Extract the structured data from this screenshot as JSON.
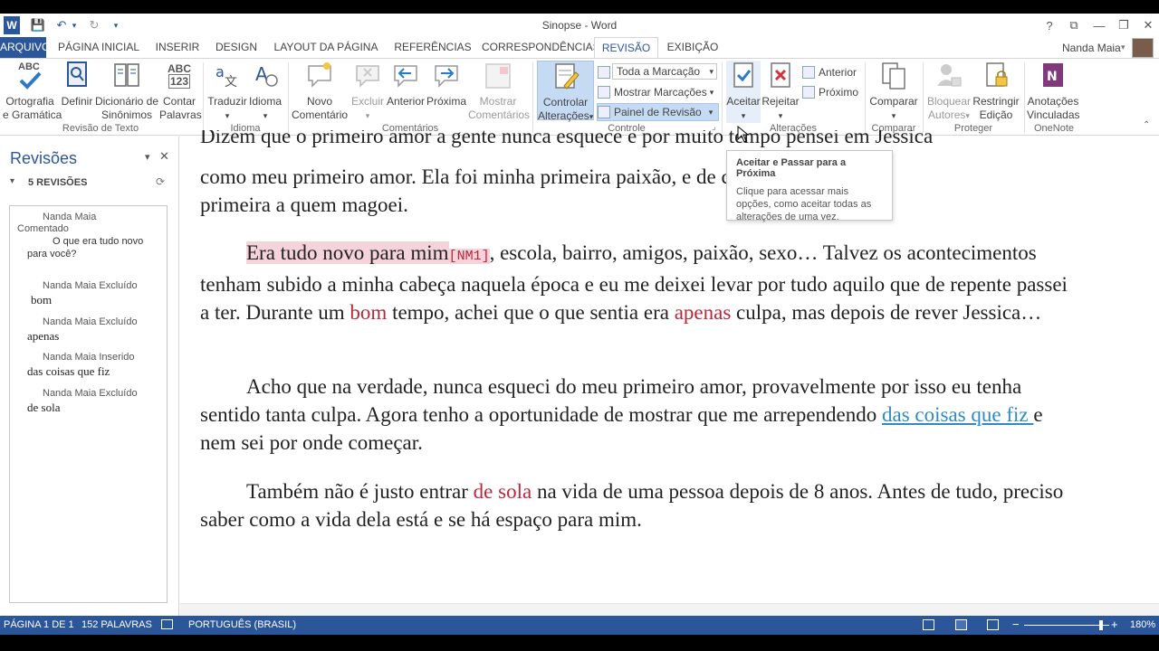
{
  "titlebar": {
    "title": "Sinopse - Word",
    "help": "?",
    "ribbon_display": "⧉",
    "minimize": "—",
    "restore": "❐",
    "close": "✕"
  },
  "qat": {
    "word_icon": "W",
    "save_icon": "💾",
    "undo_icon": "↶",
    "undo_dropdown": "▾",
    "redo_icon": "↻",
    "customize": "▾"
  },
  "tabs": [
    "ARQUIVO",
    "PÁGINA INICIAL",
    "INSERIR",
    "DESIGN",
    "LAYOUT DA PÁGINA",
    "REFERÊNCIAS",
    "CORRESPONDÊNCIAS",
    "REVISÃO",
    "EXIBIÇÃO"
  ],
  "user": {
    "name": "Nanda Maia",
    "dropdown": "▾"
  },
  "ribbon": {
    "proofing": {
      "spelling_label": [
        "Ortografia",
        "e Gramática"
      ],
      "define_label": [
        "Definir"
      ],
      "thesaurus_label": [
        "Dicionário de",
        "Sinônimos"
      ],
      "wordcount_label": [
        "Contar",
        "Palavras"
      ],
      "group": "Revisão de Texto",
      "abc": "ABC",
      "abc123": "123"
    },
    "language": {
      "translate_label": [
        "Traduzir"
      ],
      "language_label": [
        "Idioma"
      ],
      "group": "Idioma",
      "dropdown": "▾"
    },
    "comments": {
      "new_label": [
        "Novo",
        "Comentário"
      ],
      "delete_label": [
        "Excluir"
      ],
      "previous_label": [
        "Anterior"
      ],
      "next_label": [
        "Próxima"
      ],
      "show_label": [
        "Mostrar",
        "Comentários"
      ],
      "group": "Comentários"
    },
    "tracking": {
      "track_label": [
        "Controlar",
        "Alterações"
      ],
      "markup_combo": "Toda a Marcação",
      "show_markup": "Mostrar Marcações",
      "review_pane": "Painel de Revisão",
      "group": "Controle",
      "dropdown": "▾",
      "launcher": "⌟"
    },
    "changes": {
      "accept_label": [
        "Aceitar"
      ],
      "reject_label": [
        "Rejeitar"
      ],
      "previous": "Anterior",
      "next": "Próximo",
      "group": "Alterações"
    },
    "compare": {
      "compare_label": [
        "Comparar"
      ],
      "group": "Comparar"
    },
    "protect": {
      "block_label": [
        "Bloquear",
        "Autores"
      ],
      "restrict_label": [
        "Restringir",
        "Edição"
      ],
      "group": "Proteger"
    },
    "onenote": {
      "linked_label": [
        "Anotações",
        "Vinculadas"
      ],
      "group": "OneNote"
    }
  },
  "revisions_pane": {
    "title": "Revisões",
    "count": "5 REVISÕES",
    "collapse": "▾",
    "close": "✕",
    "refresh": "⟳",
    "items": [
      {
        "meta": "Nanda Maia",
        "meta2": "Comentado",
        "body": "O que era tudo novo para você?"
      },
      {
        "meta": "Nanda Maia Excluído",
        "body": "bom"
      },
      {
        "meta": "Nanda Maia Excluído",
        "body": "apenas"
      },
      {
        "meta": "Nanda Maia Inserido",
        "body": "das coisas que fiz"
      },
      {
        "meta": "Nanda Maia Excluído",
        "body": "de sola"
      }
    ]
  },
  "document": {
    "p0_line1": "Dizem que o primeiro amor a gente nunca esquece e por muito tempo pensei em Jessica",
    "p0_line2": "como meu primeiro amor. Ela foi minha primeira paixão, e de certa forma a",
    "p0_line3": "primeira a quem magoei.",
    "p1_comment_text": "Era tudo novo para mim",
    "p1_comment_marker": "[NM1]",
    "p1_a": ", escola, bairro, amigos, paixão, sexo… Talvez os acontecimentos tenham subido a minha cabeça naquela época e eu me deixei levar por tudo aquilo que de repente passei a ter. Durante um ",
    "p1_del1": "bom",
    "p1_b": " tempo, achei que o que sentia era ",
    "p1_del2": "apenas",
    "p1_c": " culpa, mas depois de rever Jessica…",
    "p2_a": "Acho que na verdade, nunca esqueci do meu primeiro amor, provavelmente por isso eu tenha sentido tanta culpa. Agora tenho a oportunidade de mostrar que me arrependendo ",
    "p2_ins": "das coisas que fiz ",
    "p2_b": "e nem sei por onde começar.",
    "p3_a": "Também não é justo entrar ",
    "p3_del": "de sola",
    "p3_b": " na vida de uma pessoa depois de 8 anos. Antes de tudo, preciso saber como a vida dela está e se há espaço para mim."
  },
  "tooltip": {
    "title": "Aceitar e Passar para a Próxima",
    "body": "Clique para acessar mais opções, como aceitar todas as alterações de uma vez."
  },
  "status": {
    "page": "PÁGINA 1 DE 1",
    "words": "152 PALAVRAS",
    "language": "PORTUGUÊS (BRASIL)",
    "zoom": "180%",
    "zoom_out": "−",
    "zoom_in": "+",
    "zoom_level": 0.9
  },
  "colors": {
    "accent": "#2b579a",
    "deleted": "#b8283a",
    "inserted": "#2f8ac0",
    "comment_highlight": "#f5d3da"
  }
}
